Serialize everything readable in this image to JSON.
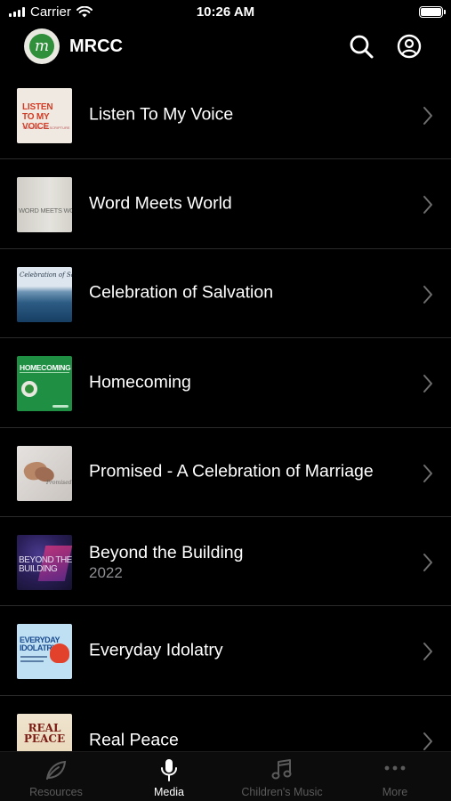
{
  "status_bar": {
    "carrier": "Carrier",
    "time": "10:26 AM"
  },
  "header": {
    "logo_letter": "m",
    "title": "MRCC",
    "search_icon": "search-icon",
    "account_icon": "account-icon"
  },
  "media_items": [
    {
      "title": "Listen To My Voice",
      "subtitle": "",
      "thumb_text": "LISTEN TO MY VOICE",
      "thumb_subtext": "THE STORY OF SCRIPTURE"
    },
    {
      "title": "Word Meets World",
      "subtitle": "",
      "thumb_text": "WORD MEETS WORLD"
    },
    {
      "title": "Celebration of Salvation",
      "subtitle": "",
      "thumb_text": "Celebration of Salvation"
    },
    {
      "title": "Homecoming",
      "subtitle": "",
      "thumb_text": "HOMECOMING"
    },
    {
      "title": "Promised - A Celebration of Marriage",
      "subtitle": "",
      "thumb_text": "Promised"
    },
    {
      "title": "Beyond the Building",
      "subtitle": "2022",
      "thumb_text": "BEYOND THE BUILDING"
    },
    {
      "title": "Everyday Idolatry",
      "subtitle": "",
      "thumb_text": "EVERYDAY IDOLATRY"
    },
    {
      "title": "Real Peace",
      "subtitle": "",
      "thumb_text": "REAL PEACE"
    }
  ],
  "tab_bar": {
    "tabs": [
      {
        "label": "Resources",
        "icon": "leaf-icon",
        "active": false
      },
      {
        "label": "Media",
        "icon": "microphone-icon",
        "active": true
      },
      {
        "label": "Children's Music",
        "icon": "music-note-icon",
        "active": false
      },
      {
        "label": "More",
        "icon": "more-dots-icon",
        "active": false
      }
    ]
  },
  "colors": {
    "background": "#000000",
    "tab_inactive": "#5b5b5b",
    "tab_active": "#ffffff",
    "separator": "#2a2a2a"
  }
}
